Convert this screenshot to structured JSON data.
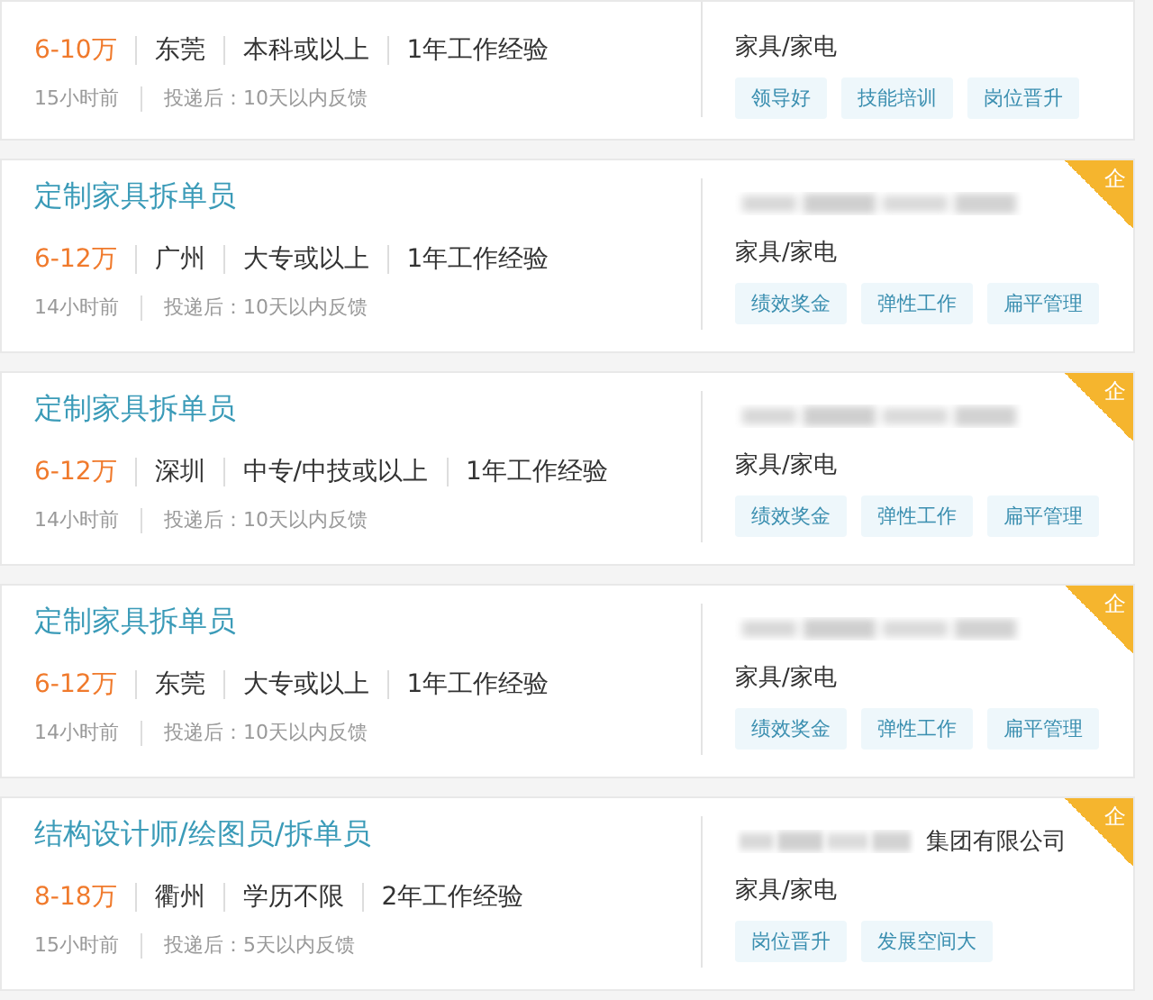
{
  "jobs": [
    {
      "salary": "6-10万",
      "city": "东莞",
      "education": "本科或以上",
      "experience": "1年工作经验",
      "posted": "15小时前",
      "feedback": "投递后：10天以内反馈",
      "industry": "家具/家电",
      "tags": [
        "领导好",
        "技能培训",
        "岗位晋升"
      ]
    },
    {
      "title": "定制家具拆单员",
      "salary": "6-12万",
      "city": "广州",
      "education": "大专或以上",
      "experience": "1年工作经验",
      "posted": "14小时前",
      "feedback": "投递后：10天以内反馈",
      "company_blurred": true,
      "industry": "家具/家电",
      "tags": [
        "绩效奖金",
        "弹性工作",
        "扁平管理"
      ],
      "badge": "企"
    },
    {
      "title": "定制家具拆单员",
      "salary": "6-12万",
      "city": "深圳",
      "education": "中专/中技或以上",
      "experience": "1年工作经验",
      "posted": "14小时前",
      "feedback": "投递后：10天以内反馈",
      "company_blurred": true,
      "industry": "家具/家电",
      "tags": [
        "绩效奖金",
        "弹性工作",
        "扁平管理"
      ],
      "badge": "企"
    },
    {
      "title": "定制家具拆单员",
      "salary": "6-12万",
      "city": "东莞",
      "education": "大专或以上",
      "experience": "1年工作经验",
      "posted": "14小时前",
      "feedback": "投递后：10天以内反馈",
      "company_blurred": true,
      "industry": "家具/家电",
      "tags": [
        "绩效奖金",
        "弹性工作",
        "扁平管理"
      ],
      "badge": "企"
    },
    {
      "title": "结构设计师/绘图员/拆单员",
      "salary": "8-18万",
      "city": "衢州",
      "education": "学历不限",
      "experience": "2年工作经验",
      "posted": "15小时前",
      "feedback": "投递后：5天以内反馈",
      "company_blurred": true,
      "company_suffix": "集团有限公司",
      "industry": "家具/家电",
      "tags": [
        "岗位晋升",
        "发展空间大"
      ],
      "badge": "企"
    }
  ]
}
